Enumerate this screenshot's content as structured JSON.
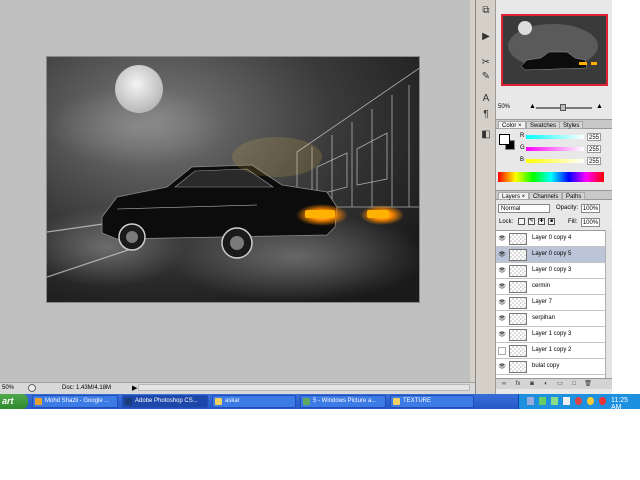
{
  "status": {
    "zoom": "50%",
    "doc": "Doc: 1.43M/4.18M",
    "arrow": "▶"
  },
  "navigator": {
    "zoom": "50%"
  },
  "color_panel": {
    "tabs": [
      "Color ×",
      "Swatches",
      "Styles"
    ],
    "sliders": [
      {
        "label": "R",
        "value": "255",
        "color": "#ff3030"
      },
      {
        "label": "G",
        "value": "255",
        "color": "#e020e0"
      },
      {
        "label": "B",
        "value": "255",
        "color": "#e8e800"
      }
    ]
  },
  "layers_panel": {
    "tabs": [
      "Layers ×",
      "Channels",
      "Paths"
    ],
    "blend_mode": "Normal",
    "opacity_label": "Opacity:",
    "opacity": "100%",
    "lock_label": "Lock:",
    "fill_label": "Fill:",
    "fill": "100%",
    "layers": [
      {
        "name": "Layer 0 copy 4",
        "visible": true
      },
      {
        "name": "Layer 0 copy 5",
        "visible": true,
        "selected": true
      },
      {
        "name": "Layer 0 copy 3",
        "visible": true
      },
      {
        "name": "cermin",
        "visible": true
      },
      {
        "name": "Layer 7",
        "visible": true
      },
      {
        "name": "serpihan",
        "visible": true
      },
      {
        "name": "Layer 1 copy 3",
        "visible": true
      },
      {
        "name": "Layer 1 copy 2",
        "visible": false
      },
      {
        "name": "bulat copy",
        "visible": true
      }
    ]
  },
  "taskbar": {
    "start_label": "art",
    "tasks": [
      {
        "label": "Mohd Shazli - Google ...",
        "icon_color": "#e8a030"
      },
      {
        "label": "Adobe Photoshop CS...",
        "icon_color": "#1a3c7a",
        "active": true
      },
      {
        "label": "askar",
        "icon_color": "#f0d060"
      },
      {
        "label": "5 - Windows Picture a...",
        "icon_color": "#60a860"
      },
      {
        "label": "TEXTURE",
        "icon_color": "#f0d060"
      }
    ],
    "clock": "11:25 AM"
  },
  "colors": {
    "workspace": "#c0c0c0",
    "taskbar": "#2458c6",
    "tail_light": "#ff9a00"
  },
  "icons": [
    "search-icon",
    "eye-icon",
    "lock-icon",
    "trash-icon",
    "new-layer-icon",
    "folder-icon"
  ]
}
